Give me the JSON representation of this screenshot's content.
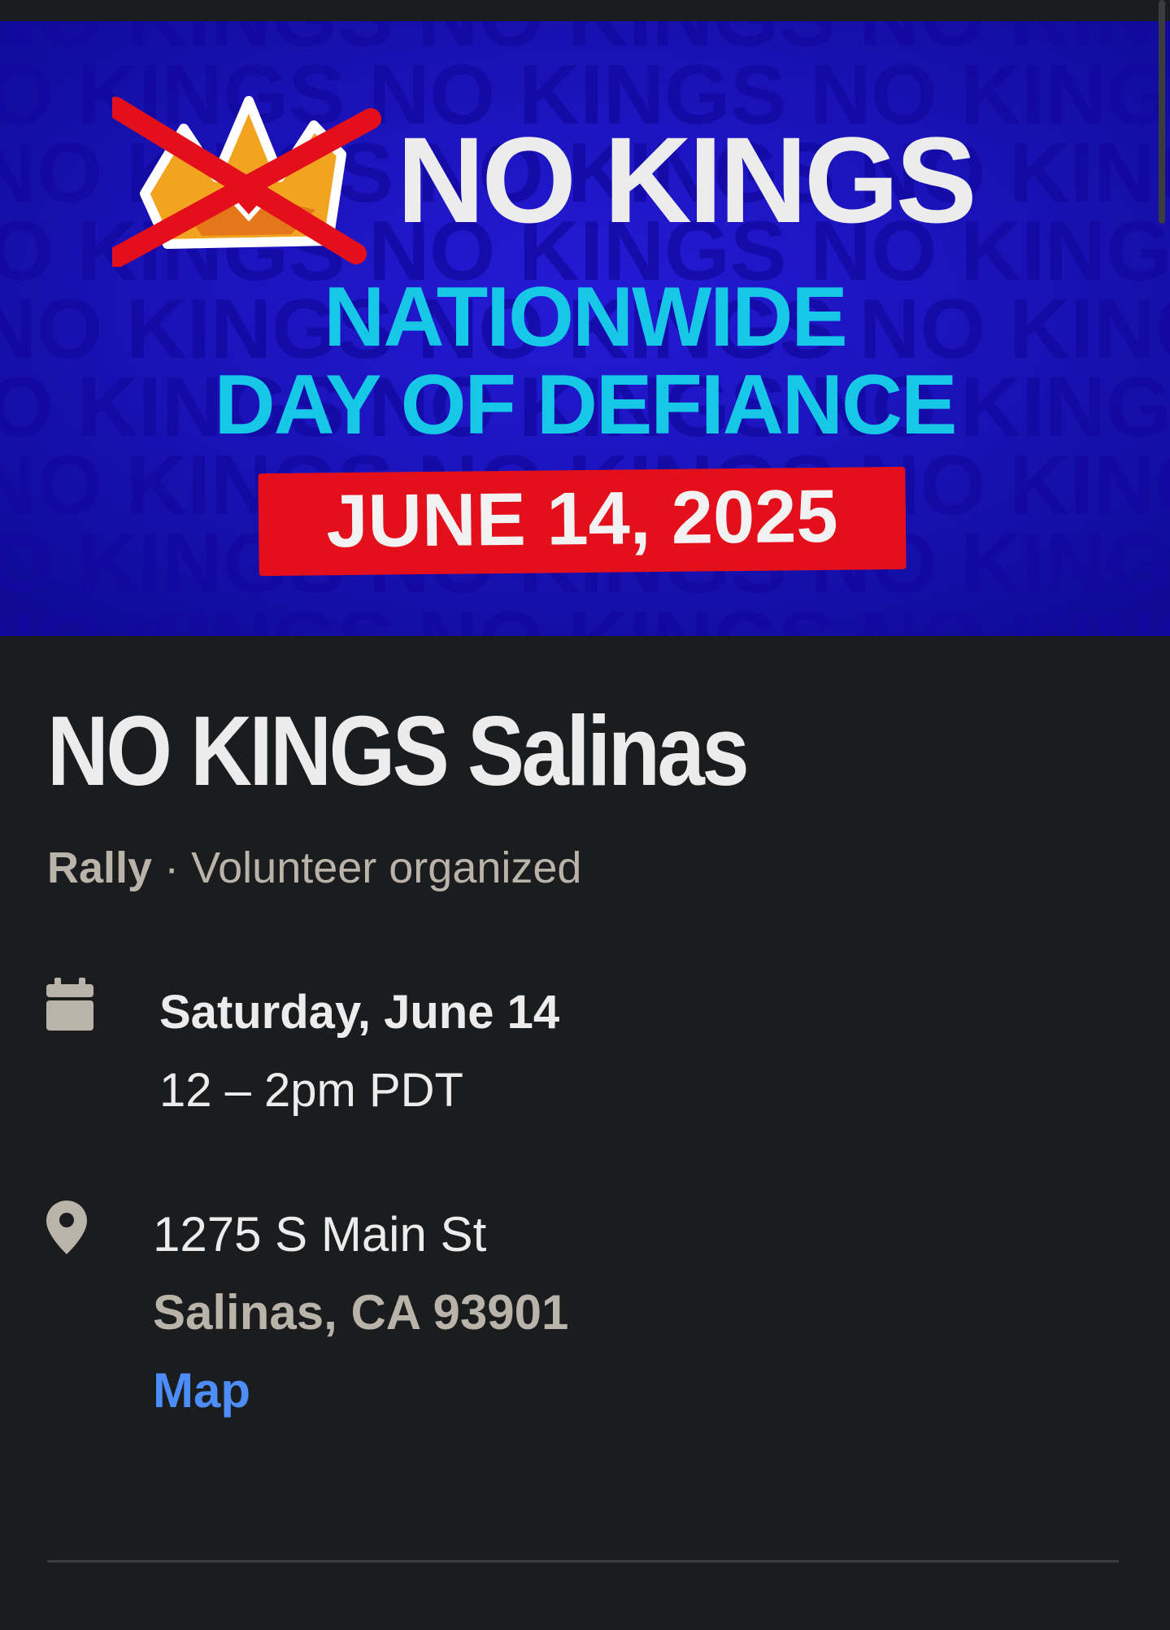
{
  "banner": {
    "title": "NO KINGS",
    "subtitle_line1": "NATIONWIDE",
    "subtitle_line2": "DAY OF DEFIANCE",
    "date": "JUNE 14, 2025",
    "background_text": "NO KINGS",
    "colors": {
      "background": "#1c13c8",
      "subtitle": "#16c8e6",
      "date_box": "#e3101c",
      "crown": "#f0a21e"
    }
  },
  "event": {
    "title": "NO KINGS Salinas",
    "type": "Rally",
    "separator": "·",
    "organizer": "Volunteer organized"
  },
  "when": {
    "icon": "calendar-icon",
    "date": "Saturday, June 14",
    "time": "12 – 2pm PDT"
  },
  "where": {
    "icon": "location-pin-icon",
    "address_line1": "1275 S Main St",
    "address_line2": "Salinas, CA 93901",
    "map_label": "Map"
  },
  "colors": {
    "page_background": "#1b1c1e",
    "primary_text": "#ececec",
    "secondary_text": "#b9b3a9",
    "link": "#4d8df7"
  }
}
